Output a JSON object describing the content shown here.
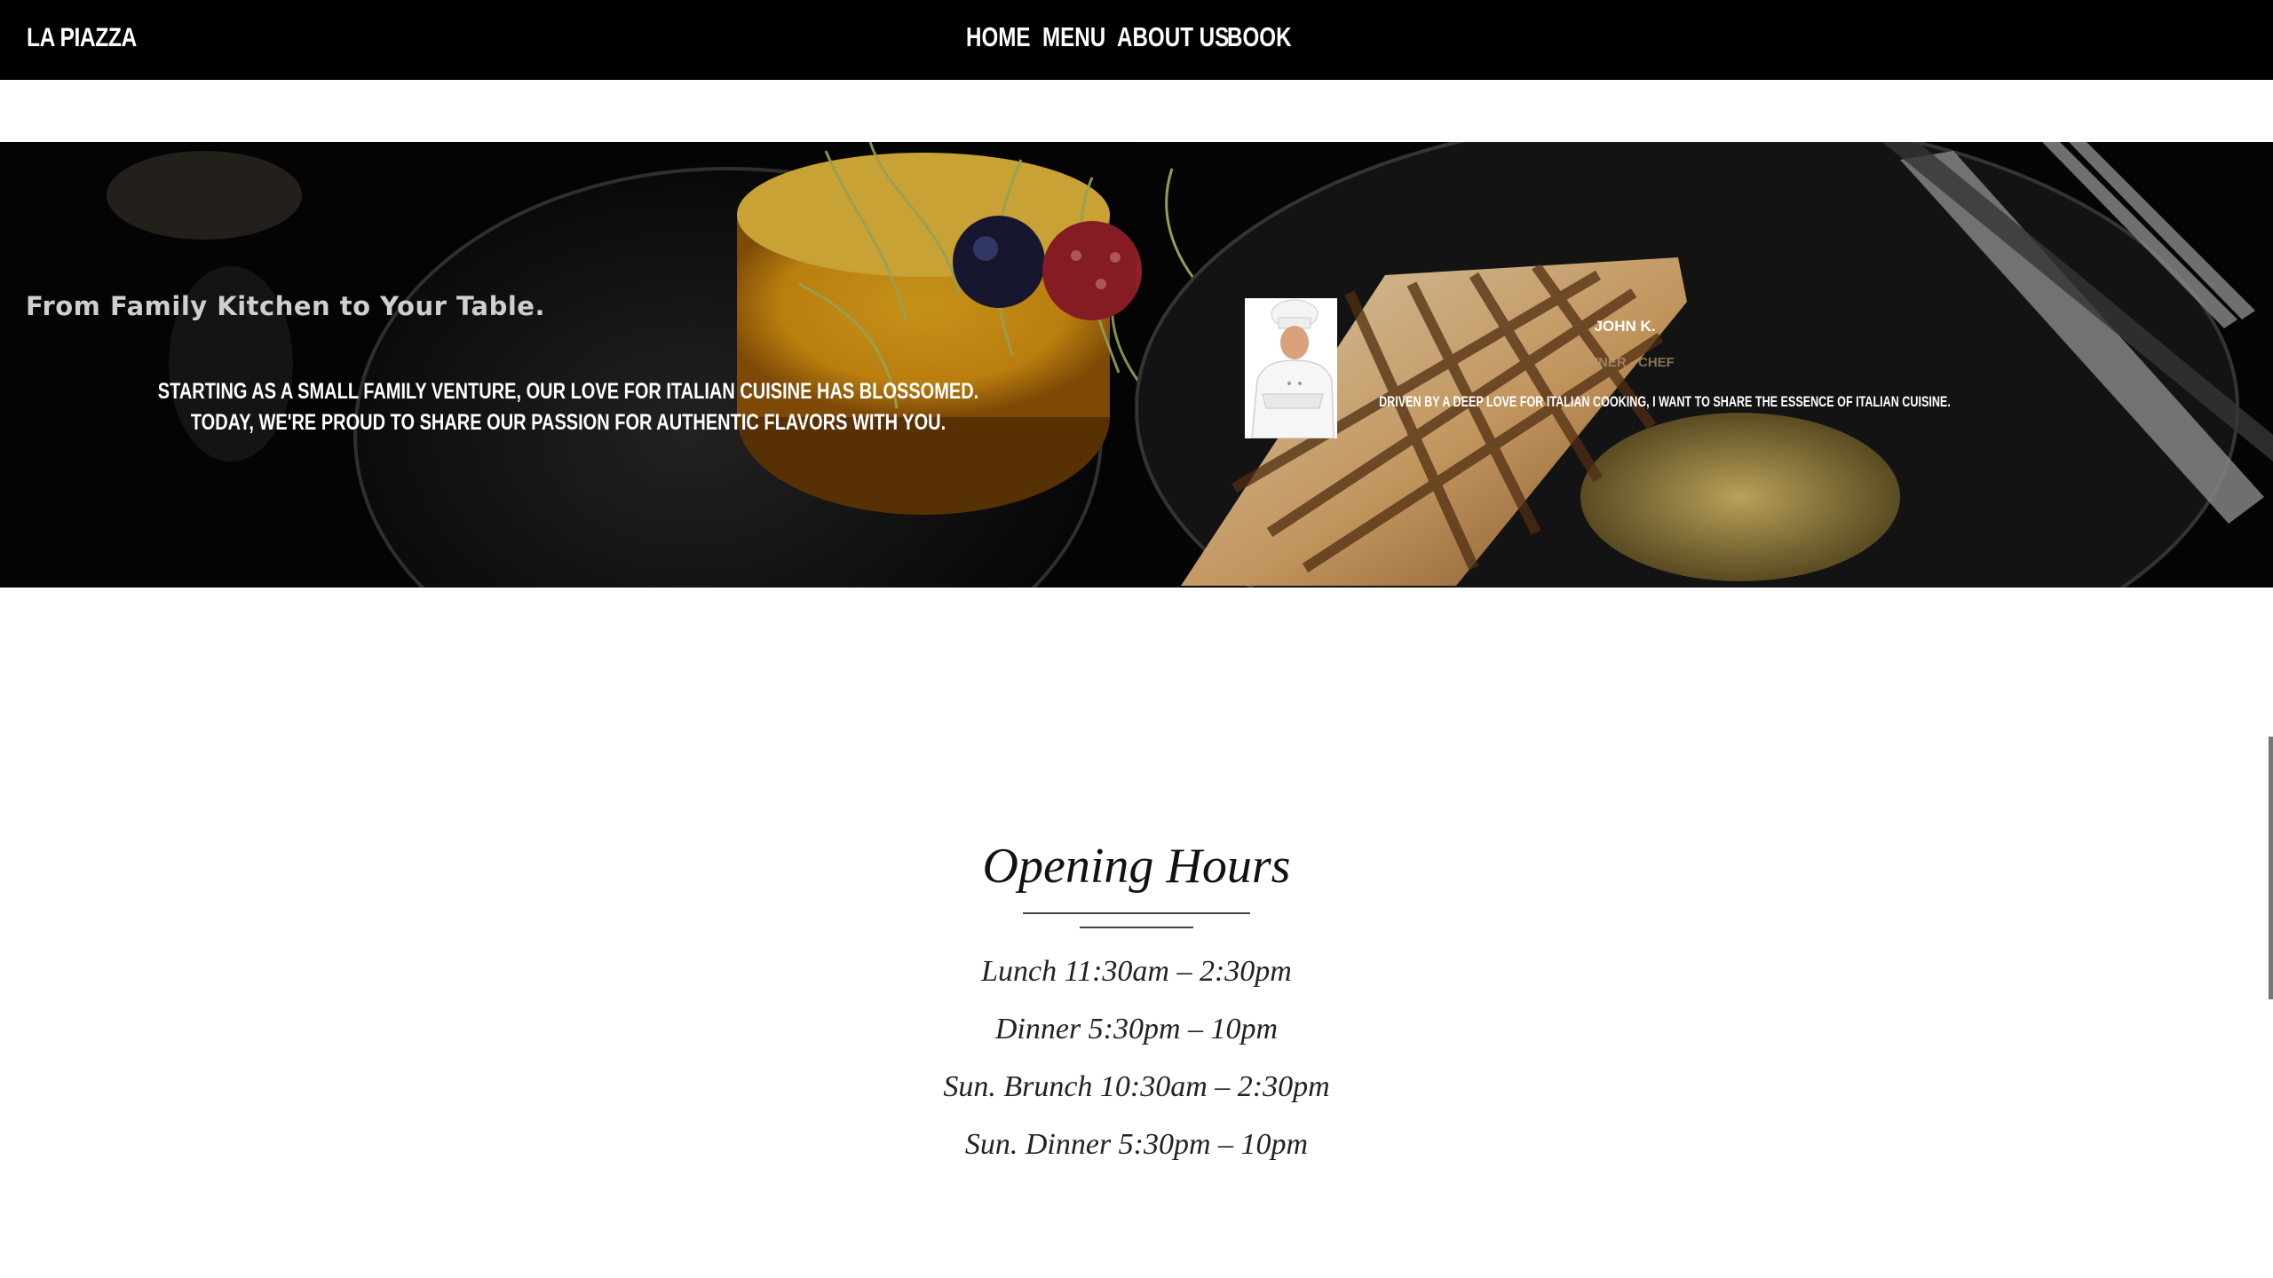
{
  "nav": {
    "brand": "LA PIAZZA",
    "links": [
      "HOME",
      "MENU",
      "ABOUT US",
      "BOOK"
    ]
  },
  "hero": {
    "tagline": "From Family Kitchen to Your Table.",
    "story": "STARTING AS A SMALL FAMILY VENTURE, OUR LOVE FOR ITALIAN CUISINE HAS BLOSSOMED. TODAY, WE'RE PROUD TO SHARE OUR PASSION FOR AUTHENTIC FLAVORS WITH YOU.",
    "chef": {
      "name": "JOHN K.",
      "role": "OWNER - CHEF",
      "quote": "DRIVEN BY A DEEP LOVE FOR ITALIAN COOKING, I WANT TO SHARE THE ESSENCE OF ITALIAN CUISINE."
    }
  },
  "hours": {
    "title": "Opening Hours",
    "items": [
      "Lunch 11:30am – 2:30pm",
      "Dinner 5:30pm – 10pm",
      "Sun. Brunch 10:30am – 2:30pm",
      "Sun. Dinner 5:30pm – 10pm"
    ]
  }
}
